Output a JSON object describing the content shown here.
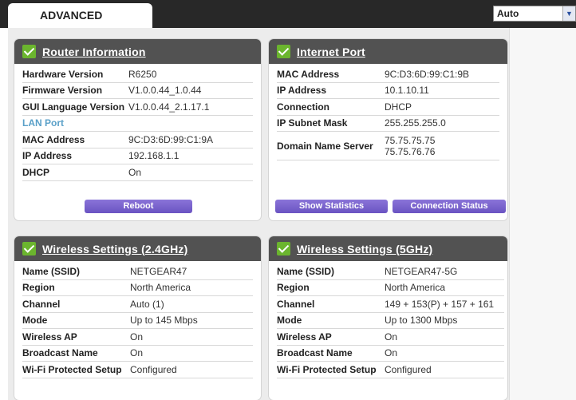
{
  "topbar": {
    "tab_label": "ADVANCED",
    "language_value": "Auto"
  },
  "router_info": {
    "title": "Router Information",
    "rows": [
      {
        "label": "Hardware Version",
        "value": "R6250"
      },
      {
        "label": "Firmware Version",
        "value": "V1.0.0.44_1.0.44"
      },
      {
        "label": "GUI Language Version",
        "value": "V1.0.0.44_2.1.17.1"
      }
    ],
    "lan_port_label": "LAN Port",
    "lan_rows": [
      {
        "label": "MAC Address",
        "value": "9C:D3:6D:99:C1:9A"
      },
      {
        "label": "IP Address",
        "value": "192.168.1.1"
      },
      {
        "label": "DHCP",
        "value": "On"
      }
    ],
    "reboot_label": "Reboot"
  },
  "internet_port": {
    "title": "Internet Port",
    "rows": [
      {
        "label": "MAC Address",
        "value": "9C:D3:6D:99:C1:9B"
      },
      {
        "label": "IP Address",
        "value": "10.1.10.11"
      },
      {
        "label": "Connection",
        "value": "DHCP"
      },
      {
        "label": "IP Subnet Mask",
        "value": "255.255.255.0"
      }
    ],
    "dns_label": "Domain Name Server",
    "dns_values": [
      "75.75.75.75",
      "75.75.76.76"
    ],
    "show_statistics_label": "Show Statistics",
    "connection_status_label": "Connection Status"
  },
  "wireless_24": {
    "title": "Wireless Settings (2.4GHz)",
    "rows": [
      {
        "label": "Name (SSID)",
        "value": "NETGEAR47"
      },
      {
        "label": "Region",
        "value": "North America"
      },
      {
        "label": "Channel",
        "value": "Auto (1)"
      },
      {
        "label": "Mode",
        "value": "Up to 145 Mbps"
      },
      {
        "label": "Wireless AP",
        "value": "On"
      },
      {
        "label": "Broadcast Name",
        "value": "On"
      },
      {
        "label": "Wi-Fi Protected Setup",
        "value": "Configured"
      }
    ]
  },
  "wireless_5": {
    "title": "Wireless Settings (5GHz)",
    "rows": [
      {
        "label": "Name (SSID)",
        "value": "NETGEAR47-5G"
      },
      {
        "label": "Region",
        "value": "North America"
      },
      {
        "label": "Channel",
        "value": "149 + 153(P) + 157 + 161"
      },
      {
        "label": "Mode",
        "value": "Up to 1300 Mbps"
      },
      {
        "label": "Wireless AP",
        "value": "On"
      },
      {
        "label": "Broadcast Name",
        "value": "On"
      },
      {
        "label": "Wi-Fi Protected Setup",
        "value": "Configured"
      }
    ]
  }
}
